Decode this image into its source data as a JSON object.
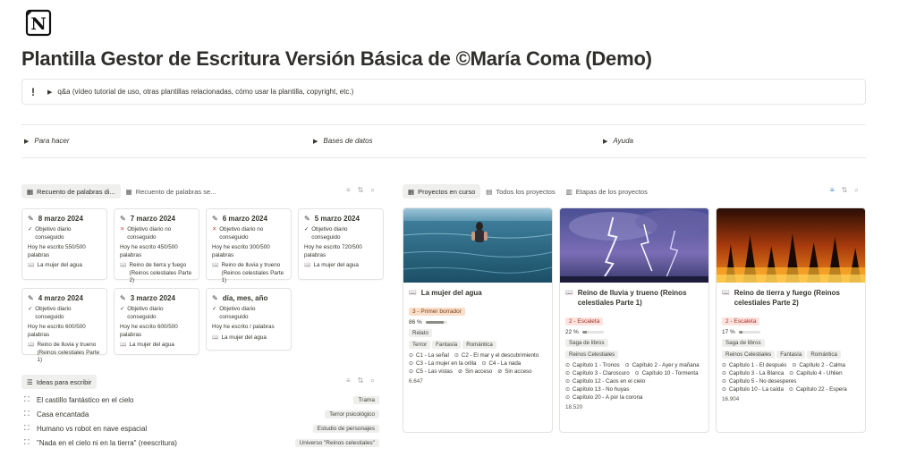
{
  "page": {
    "title": "Plantilla Gestor de Escritura Versión Básica de ©María Coma (Demo)"
  },
  "callout": {
    "icon": "!",
    "text": "q&a (vídeo tutorial de uso, otras plantillas relacionadas, cómo usar la plantilla, copyright, etc.)"
  },
  "toggles": [
    "Para hacer",
    "Bases de datos",
    "Ayuda"
  ],
  "word_count": {
    "tabs": [
      "Recuento de palabras di...",
      "Recuento de palabras se..."
    ],
    "cards": [
      {
        "date": "8 marzo 2024",
        "status": "ok",
        "objective": "Objetivo diario conseguido",
        "words": "Hoy he escrito 550/500 palabras",
        "project": "La mujer del agua"
      },
      {
        "date": "7 marzo 2024",
        "status": "no",
        "objective": "Objetivo diario no conseguido",
        "words": "Hoy he escrito 450/500 palabras",
        "project": "Reino de tierra y fuego (Reinos celestiales Parte 2)"
      },
      {
        "date": "6 marzo 2024",
        "status": "no",
        "objective": "Objetivo diario no conseguido",
        "words": "Hoy he escrito 300/500 palabras",
        "project": "Reino de lluvia y trueno (Reinos celestiales Parte 1)"
      },
      {
        "date": "5 marzo 2024",
        "status": "ok",
        "objective": "Objetivo diario conseguido",
        "words": "Hoy he escrito 720/500 palabras",
        "project": "La mujer del agua"
      },
      {
        "date": "4 marzo 2024",
        "status": "ok",
        "objective": "Objetivo diario conseguido",
        "words": "Hoy he escrito 600/500 palabras",
        "project": "Reino de lluvia y trueno (Reinos celestiales Parte 1)"
      },
      {
        "date": "3 marzo 2024",
        "status": "ok",
        "objective": "Objetivo diario conseguido",
        "words": "Hoy he escrito 600/500 palabras",
        "project": "La mujer del agua"
      },
      {
        "date": "día, mes, año",
        "status": "ok",
        "objective": "Objetivo diario conseguido",
        "words": "Hoy he escrito / palabras",
        "project": "La mujer del agua"
      }
    ]
  },
  "ideas": {
    "tab": "Ideas para escribir",
    "rows": [
      {
        "title": "El castillo fantástico en el cielo",
        "tag": "Trama"
      },
      {
        "title": "Casa encantada",
        "tag": "Terror psicológico"
      },
      {
        "title": "Humano vs robot en nave espacial",
        "tag": "Estudio de personajes"
      },
      {
        "title": "\"Nada en el cielo ni en la tierra\" (reescritura)",
        "tag": "Universo \"Reinos celestiales\""
      }
    ]
  },
  "projects": {
    "tabs": [
      "Proyectos en curso",
      "Todos los proyectos",
      "Etapas de los proyectos"
    ],
    "cards": [
      {
        "title": "La mujer del agua",
        "stage": "3 - Primer borrador",
        "stage_color": "orange",
        "progress_label": "86 %",
        "progress": 0.86,
        "type": "Relato",
        "genres": [
          "Terror",
          "Fantasía",
          "Romántica"
        ],
        "chapters": [
          "C1 - La señal",
          "C2 - El mar y el descubrimiento",
          "C3 - La mujer en la orilla",
          "C4 - La nada",
          "C5 - Las vistas",
          "Sin acceso",
          "Sin acceso"
        ],
        "words": "6.647"
      },
      {
        "title": "Reino de lluvia y trueno (Reinos celestiales Parte 1)",
        "stage": "2 - Escaleta",
        "stage_color": "red",
        "progress_label": "22 %",
        "progress": 0.22,
        "type": "Saga de libros",
        "genres": [
          "Reinos Celestiales"
        ],
        "chapters": [
          "Capítulo 1 - Tronos",
          "Capítulo 2 - Ayer y mañana",
          "Capítulo 3 - Claroscuro",
          "Capítulo 10 - Tormenta",
          "Capítulo 12 - Caos en el cielo",
          "Capítulo 13 - No huyas",
          "Capítulo 20 - A por la corona"
        ],
        "words": "18.520"
      },
      {
        "title": "Reino de tierra y fuego (Reinos celestiales Parte 2)",
        "stage": "2 - Escaleta",
        "stage_color": "red",
        "progress_label": "17 %",
        "progress": 0.17,
        "type": "Saga de libros",
        "genres": [
          "Reinos Celestiales",
          "Fantasía",
          "Romántica"
        ],
        "chapters": [
          "Capítulo 1 - El después",
          "Capítulo 2 - Calma",
          "Capítulo 3 - La Blanca",
          "Capítulo 4 - Uhlien",
          "Capítulo 5 - No desesperes",
          "Capítulo 10 - La caída",
          "Capítulo 22 - Espera"
        ],
        "words": "16.904"
      }
    ]
  }
}
